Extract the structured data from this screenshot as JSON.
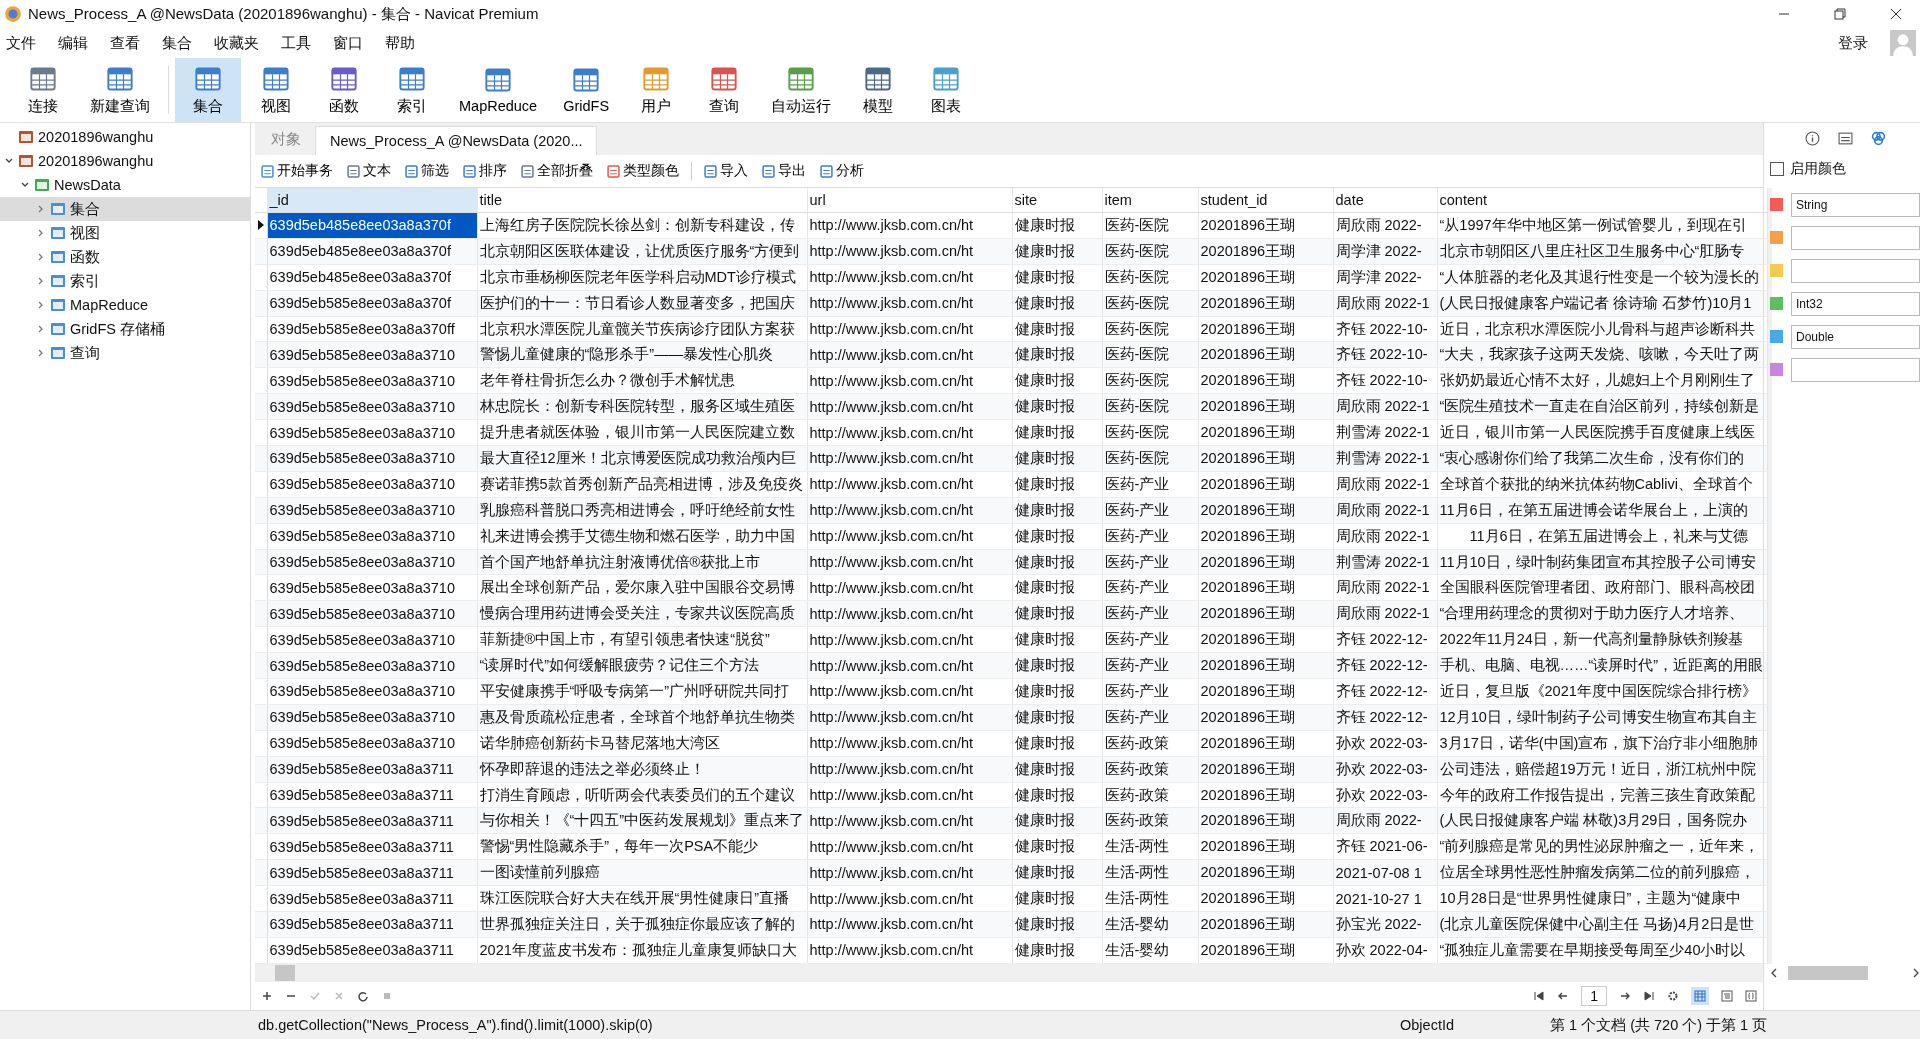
{
  "window": {
    "title": "News_Process_A @NewsData (20201896wanghu) - 集合 - Navicat Premium"
  },
  "menu": [
    "文件",
    "编辑",
    "查看",
    "集合",
    "收藏夹",
    "工具",
    "窗口",
    "帮助"
  ],
  "login": "登录",
  "toolbar": [
    {
      "label": "连接",
      "selected": false
    },
    {
      "label": "新建查询",
      "selected": false
    },
    {
      "label": "集合",
      "selected": true
    },
    {
      "label": "视图",
      "selected": false
    },
    {
      "label": "函数",
      "selected": false
    },
    {
      "label": "索引",
      "selected": false
    },
    {
      "label": "MapReduce",
      "selected": false
    },
    {
      "label": "GridFS",
      "selected": false
    },
    {
      "label": "用户",
      "selected": false
    },
    {
      "label": "查询",
      "selected": false
    },
    {
      "label": "自动运行",
      "selected": false
    },
    {
      "label": "模型",
      "selected": false
    },
    {
      "label": "图表",
      "selected": false
    }
  ],
  "sidebar": {
    "items": [
      {
        "label": "20201896wanghu",
        "selected": false
      },
      {
        "label": "20201896wanghu",
        "expanded": true,
        "selected": false,
        "children": [
          {
            "label": "NewsData",
            "expanded": true,
            "selected": false,
            "children": [
              {
                "label": "集合",
                "expanded": false,
                "selected": true
              },
              {
                "label": "视图",
                "expanded": false,
                "selected": false
              },
              {
                "label": "函数",
                "expanded": false,
                "selected": false
              },
              {
                "label": "索引",
                "expanded": false,
                "selected": false
              },
              {
                "label": "MapReduce",
                "expanded": false,
                "selected": false
              },
              {
                "label": "GridFS 存储桶",
                "expanded": false,
                "selected": false
              },
              {
                "label": "查询",
                "expanded": false,
                "selected": false
              }
            ]
          }
        ]
      }
    ]
  },
  "tabs": [
    {
      "label": "对象",
      "selected": false
    },
    {
      "label": "News_Process_A @NewsData (2020...",
      "selected": true
    }
  ],
  "actions": [
    "开始事务",
    "文本",
    "筛选",
    "排序",
    "全部折叠",
    "类型颜色",
    "导入",
    "导出",
    "分析"
  ],
  "table": {
    "columns": [
      "_id",
      "title",
      "url",
      "site",
      "item",
      "student_id",
      "date",
      "content"
    ],
    "rows": [
      {
        "selected": true,
        "cells": [
          "639d5eb485e8ee03a8a370f",
          "上海红房子医院院长徐丛剑：创新专科建设，传",
          "http://www.jksb.com.cn/ht",
          "健康时报",
          "医药-医院",
          "20201896王瑚",
          "周欣雨 2022-",
          "“从1997年华中地区第一例试管婴儿，到现在引"
        ]
      },
      {
        "selected": false,
        "cells": [
          "639d5eb485e8ee03a8a370f",
          "北京朝阳区医联体建设，让优质医疗服务“方便到",
          "http://www.jksb.com.cn/ht",
          "健康时报",
          "医药-医院",
          "20201896王瑚",
          "周学津 2022-",
          "北京市朝阳区八里庄社区卫生服务中心“肛肠专"
        ]
      },
      {
        "selected": false,
        "cells": [
          "639d5eb485e8ee03a8a370f",
          "北京市垂杨柳医院老年医学科启动MDT诊疗模式",
          "http://www.jksb.com.cn/ht",
          "健康时报",
          "医药-医院",
          "20201896王瑚",
          "周学津 2022-",
          "“人体脏器的老化及其退行性变是一个较为漫长的"
        ]
      },
      {
        "selected": false,
        "cells": [
          "639d5eb585e8ee03a8a370f",
          "医护们的十一：节日看诊人数显著变多，把国庆",
          "http://www.jksb.com.cn/ht",
          "健康时报",
          "医药-医院",
          "20201896王瑚",
          "周欣雨 2022-1",
          "(人民日报健康客户端记者 徐诗瑜 石梦竹)10月1"
        ]
      },
      {
        "selected": false,
        "cells": [
          "639d5eb585e8ee03a8a370ff",
          "北京积水潭医院儿童髋关节疾病诊疗团队方案获",
          "http://www.jksb.com.cn/ht",
          "健康时报",
          "医药-医院",
          "20201896王瑚",
          "齐钰 2022-10-",
          "近日，北京积水潭医院小儿骨科与超声诊断科共"
        ]
      },
      {
        "selected": false,
        "cells": [
          "639d5eb585e8ee03a8a3710",
          "警惕儿童健康的“隐形杀手”——暴发性心肌炎",
          "http://www.jksb.com.cn/ht",
          "健康时报",
          "医药-医院",
          "20201896王瑚",
          "齐钰 2022-10-",
          "“大夫，我家孩子这两天发烧、咳嗽，今天吐了两"
        ]
      },
      {
        "selected": false,
        "cells": [
          "639d5eb585e8ee03a8a3710",
          "老年脊柱骨折怎么办？微创手术解忧患",
          "http://www.jksb.com.cn/ht",
          "健康时报",
          "医药-医院",
          "20201896王瑚",
          "齐钰 2022-10-",
          "张奶奶最近心情不太好，儿媳妇上个月刚刚生了"
        ]
      },
      {
        "selected": false,
        "cells": [
          "639d5eb585e8ee03a8a3710",
          "林忠院长：创新专科医院转型，服务区域生殖医",
          "http://www.jksb.com.cn/ht",
          "健康时报",
          "医药-医院",
          "20201896王瑚",
          "周欣雨 2022-1",
          "“医院生殖技术一直走在自治区前列，持续创新是"
        ]
      },
      {
        "selected": false,
        "cells": [
          "639d5eb585e8ee03a8a3710",
          "提升患者就医体验，银川市第一人民医院建立数",
          "http://www.jksb.com.cn/ht",
          "健康时报",
          "医药-医院",
          "20201896王瑚",
          "荆雪涛 2022-1",
          "近日，银川市第一人民医院携手百度健康上线医"
        ]
      },
      {
        "selected": false,
        "cells": [
          "639d5eb585e8ee03a8a3710",
          "最大直径12厘米！北京博爱医院成功救治颅内巨",
          "http://www.jksb.com.cn/ht",
          "健康时报",
          "医药-医院",
          "20201896王瑚",
          "荆雪涛 2022-1",
          "“衷心感谢你们给了我第二次生命，没有你们的"
        ]
      },
      {
        "selected": false,
        "cells": [
          "639d5eb585e8ee03a8a3710",
          "赛诺菲携5款首秀创新产品亮相进博，涉及免疫炎",
          "http://www.jksb.com.cn/ht",
          "健康时报",
          "医药-产业",
          "20201896王瑚",
          "周欣雨 2022-1",
          "全球首个获批的纳米抗体药物Cablivi、全球首个"
        ]
      },
      {
        "selected": false,
        "cells": [
          "639d5eb585e8ee03a8a3710",
          "乳腺癌科普脱口秀亮相进博会，呼吁绝经前女性",
          "http://www.jksb.com.cn/ht",
          "健康时报",
          "医药-产业",
          "20201896王瑚",
          "周欣雨 2022-1",
          "11月6日，在第五届进博会诺华展台上，上演的"
        ]
      },
      {
        "selected": false,
        "cells": [
          "639d5eb585e8ee03a8a3710",
          "礼来进博会携手艾德生物和燃石医学，助力中国",
          "http://www.jksb.com.cn/ht",
          "健康时报",
          "医药-产业",
          "20201896王瑚",
          "周欣雨 2022-1",
          "　　11月6日，在第五届进博会上，礼来与艾德"
        ]
      },
      {
        "selected": false,
        "cells": [
          "639d5eb585e8ee03a8a3710",
          "首个国产地舒单抗注射液博优倍®获批上市",
          "http://www.jksb.com.cn/ht",
          "健康时报",
          "医药-产业",
          "20201896王瑚",
          "荆雪涛 2022-1",
          "11月10日，绿叶制药集团宣布其控股子公司博安"
        ]
      },
      {
        "selected": false,
        "cells": [
          "639d5eb585e8ee03a8a3710",
          "展出全球创新产品，爱尔康入驻中国眼谷交易博",
          "http://www.jksb.com.cn/ht",
          "健康时报",
          "医药-产业",
          "20201896王瑚",
          "周欣雨 2022-1",
          "全国眼科医院管理者团、政府部门、眼科高校团"
        ]
      },
      {
        "selected": false,
        "cells": [
          "639d5eb585e8ee03a8a3710",
          "慢病合理用药进博会受关注，专家共议医院高质",
          "http://www.jksb.com.cn/ht",
          "健康时报",
          "医药-产业",
          "20201896王瑚",
          "周欣雨 2022-1",
          "“合理用药理念的贯彻对于助力医疗人才培养、"
        ]
      },
      {
        "selected": false,
        "cells": [
          "639d5eb585e8ee03a8a3710",
          "菲新捷®中国上市，有望引领患者快速“脱贫”",
          "http://www.jksb.com.cn/ht",
          "健康时报",
          "医药-产业",
          "20201896王瑚",
          "齐钰 2022-12-",
          "2022年11月24日，新一代高剂量静脉铁剂羧基"
        ]
      },
      {
        "selected": false,
        "cells": [
          "639d5eb585e8ee03a8a3710",
          "“读屏时代”如何缓解眼疲劳？记住三个方法",
          "http://www.jksb.com.cn/ht",
          "健康时报",
          "医药-产业",
          "20201896王瑚",
          "齐钰 2022-12-",
          "手机、电脑、电视……“读屏时代”，近距离的用眼"
        ]
      },
      {
        "selected": false,
        "cells": [
          "639d5eb585e8ee03a8a3710",
          "平安健康携手“呼吸专病第一”广州呼研院共同打",
          "http://www.jksb.com.cn/ht",
          "健康时报",
          "医药-产业",
          "20201896王瑚",
          "齐钰 2022-12-",
          "近日，复旦版《2021年度中国医院综合排行榜》"
        ]
      },
      {
        "selected": false,
        "cells": [
          "639d5eb585e8ee03a8a3710",
          "惠及骨质疏松症患者，全球首个地舒单抗生物类",
          "http://www.jksb.com.cn/ht",
          "健康时报",
          "医药-产业",
          "20201896王瑚",
          "齐钰 2022-12-",
          "12月10日，绿叶制药子公司博安生物宣布其自主"
        ]
      },
      {
        "selected": false,
        "cells": [
          "639d5eb585e8ee03a8a3710",
          "诺华肺癌创新药卡马替尼落地大湾区",
          "http://www.jksb.com.cn/ht",
          "健康时报",
          "医药-政策",
          "20201896王瑚",
          "孙欢 2022-03-",
          "3月17日，诺华(中国)宣布，旗下治疗非小细胞肺"
        ]
      },
      {
        "selected": false,
        "cells": [
          "639d5eb585e8ee03a8a3711",
          "怀孕即辞退的违法之举必须终止！",
          "http://www.jksb.com.cn/ht",
          "健康时报",
          "医药-政策",
          "20201896王瑚",
          "孙欢 2022-03-",
          "公司违法，赔偿超19万元！近日，浙江杭州中院"
        ]
      },
      {
        "selected": false,
        "cells": [
          "639d5eb585e8ee03a8a3711",
          "打消生育顾虑，听听两会代表委员们的五个建议",
          "http://www.jksb.com.cn/ht",
          "健康时报",
          "医药-政策",
          "20201896王瑚",
          "孙欢 2022-03-",
          "今年的政府工作报告提出，完善三孩生育政策配"
        ]
      },
      {
        "selected": false,
        "cells": [
          "639d5eb585e8ee03a8a3711",
          "与你相关！《“十四五”中医药发展规划》重点来了",
          "http://www.jksb.com.cn/ht",
          "健康时报",
          "医药-政策",
          "20201896王瑚",
          "周欣雨 2022-",
          "(人民日报健康客户端 林敬)3月29日，国务院办"
        ]
      },
      {
        "selected": false,
        "cells": [
          "639d5eb585e8ee03a8a3711",
          "警惕“男性隐藏杀手”，每年一次PSA不能少",
          "http://www.jksb.com.cn/ht",
          "健康时报",
          "生活-两性",
          "20201896王瑚",
          "齐钰 2021-06-",
          "“前列腺癌是常见的男性泌尿肿瘤之一，近年来，"
        ]
      },
      {
        "selected": false,
        "cells": [
          "639d5eb585e8ee03a8a3711",
          "一图读懂前列腺癌",
          "http://www.jksb.com.cn/ht",
          "健康时报",
          "生活-两性",
          "20201896王瑚",
          "2021-07-08 1",
          "位居全球男性恶性肿瘤发病第二位的前列腺癌，"
        ]
      },
      {
        "selected": false,
        "cells": [
          "639d5eb585e8ee03a8a3711",
          "珠江医院联合好大夫在线开展“男性健康日”直播",
          "http://www.jksb.com.cn/ht",
          "健康时报",
          "生活-两性",
          "20201896王瑚",
          "2021-10-27 1",
          "10月28日是“世界男性健康日”，主题为“健康中"
        ]
      },
      {
        "selected": false,
        "cells": [
          "639d5eb585e8ee03a8a3711",
          "世界孤独症关注日，关于孤独症你最应该了解的",
          "http://www.jksb.com.cn/ht",
          "健康时报",
          "生活-婴幼",
          "20201896王瑚",
          "孙宝光 2022-",
          "(北京儿童医院保健中心副主任 马扬)4月2日是世"
        ]
      },
      {
        "selected": false,
        "cells": [
          "639d5eb585e8ee03a8a3711",
          "2021年度蓝皮书发布：孤独症儿童康复师缺口大",
          "http://www.jksb.com.cn/ht",
          "健康时报",
          "生活-婴幼",
          "20201896王瑚",
          "孙欢 2022-04-",
          "“孤独症儿童需要在早期接受每周至少40小时以"
        ]
      }
    ]
  },
  "pager": {
    "page": "1"
  },
  "type_colors": {
    "enable": {
      "label": "启用颜色",
      "checked": false
    },
    "items": [
      {
        "color": "#f25c54",
        "label": "String"
      },
      {
        "color": "#f5a04a"
      },
      {
        "color": "#f2cc4f"
      },
      {
        "color": "#5fbf5a",
        "label": "Int32"
      },
      {
        "color": "#49a9e8",
        "label": "Double"
      },
      {
        "color": "#c986de"
      }
    ]
  },
  "status_bar": {
    "query": "db.getCollection(\"News_Process_A\").find().limit(1000).skip(0)",
    "type": "ObjectId",
    "position": "第 1 个文档 (共 720 个) 于第 1 页"
  }
}
